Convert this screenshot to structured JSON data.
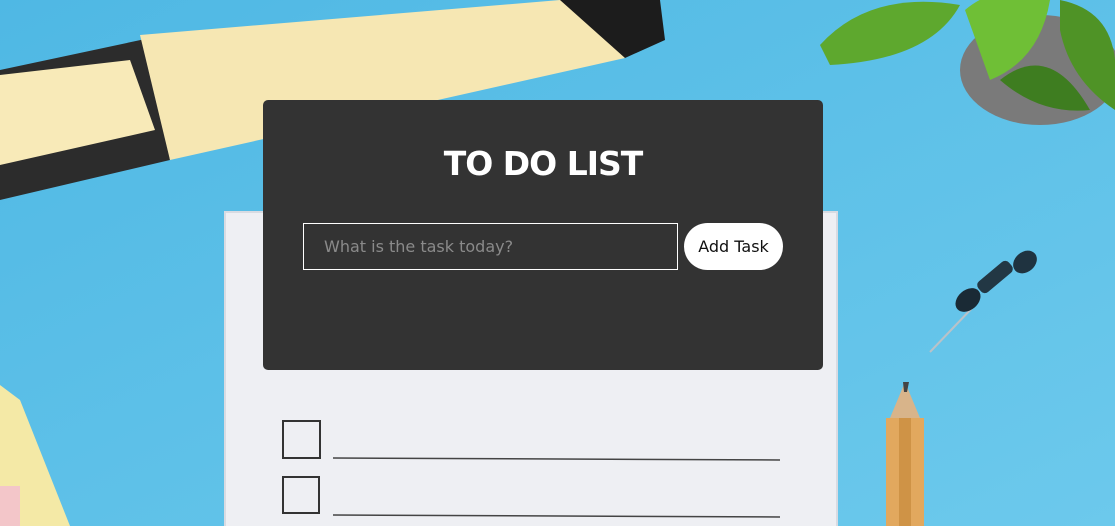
{
  "app": {
    "title": "TO DO LIST"
  },
  "form": {
    "task_input": {
      "value": "",
      "placeholder": "What is the task today?"
    },
    "add_button_label": "Add Task"
  },
  "background": {
    "description_icons": [
      "highlighter-icon",
      "plant-icon",
      "notepad-icon",
      "pushpin-icon",
      "pencil-icon"
    ],
    "accent_color": "#5cc0e6"
  }
}
